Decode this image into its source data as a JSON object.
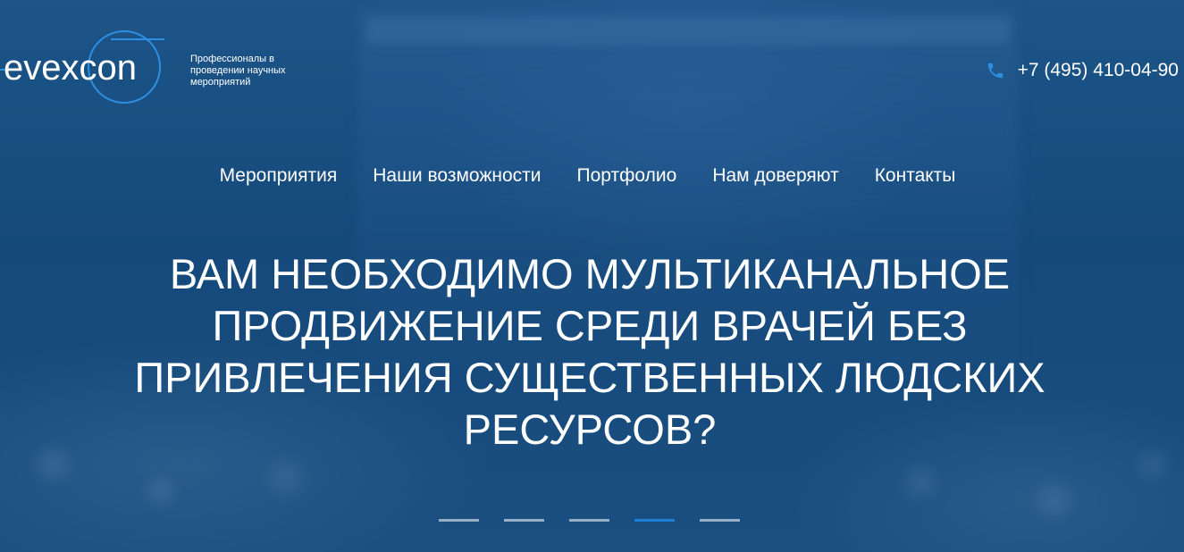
{
  "header": {
    "logo_text": "evexcon",
    "tagline": "Профессионалы в проведении научных мероприятий",
    "phone": "+7 (495) 410-04-90",
    "phone_icon": "phone-icon"
  },
  "nav": {
    "items": [
      {
        "label": "Мероприятия"
      },
      {
        "label": "Наши возможности"
      },
      {
        "label": "Портфолио"
      },
      {
        "label": "Нам доверяют"
      },
      {
        "label": "Контакты"
      }
    ]
  },
  "hero": {
    "headline": "ВАМ НЕОБХОДИМО МУЛЬТИКАНАЛЬНОЕ ПРОДВИЖЕНИЕ СРЕДИ ВРАЧЕЙ БЕЗ ПРИВЛЕЧЕНИЯ СУЩЕСТВЕННЫХ ЛЮДСКИХ РЕСУРСОВ?"
  },
  "slider": {
    "slide_count": 5,
    "active_index": 3
  },
  "colors": {
    "accent": "#1f7fd4",
    "logo_ring": "#2e8fe0",
    "background": "#15497b"
  }
}
